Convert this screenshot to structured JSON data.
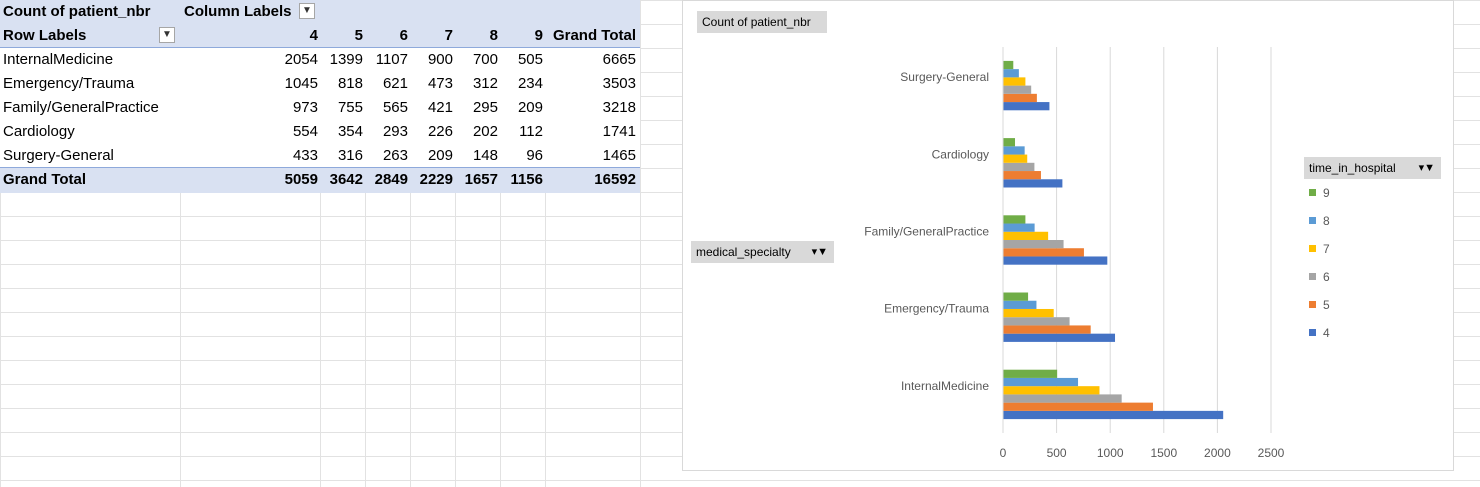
{
  "pivot": {
    "title": "Count of patient_nbr",
    "column_labels": "Column Labels",
    "row_labels": "Row Labels",
    "column_headers": [
      "4",
      "5",
      "6",
      "7",
      "8",
      "9",
      "Grand Total"
    ],
    "rows": [
      {
        "label": "InternalMedicine",
        "values": [
          "2054",
          "1399",
          "1107",
          "900",
          "700",
          "505",
          "6665"
        ]
      },
      {
        "label": "Emergency/Trauma",
        "values": [
          "1045",
          "818",
          "621",
          "473",
          "312",
          "234",
          "3503"
        ]
      },
      {
        "label": "Family/GeneralPractice",
        "values": [
          "973",
          "755",
          "565",
          "421",
          "295",
          "209",
          "3218"
        ]
      },
      {
        "label": "Cardiology",
        "values": [
          "554",
          "354",
          "293",
          "226",
          "202",
          "112",
          "1741"
        ]
      },
      {
        "label": "Surgery-General",
        "values": [
          "433",
          "316",
          "263",
          "209",
          "148",
          "96",
          "1465"
        ]
      }
    ],
    "grand_total": {
      "label": "Grand Total",
      "values": [
        "5059",
        "3642",
        "2849",
        "2229",
        "1657",
        "1156",
        "16592"
      ]
    }
  },
  "chart": {
    "value_field_button": "Count  of patient_nbr",
    "axis_field_button": "medical_specialty",
    "legend_field_button": "time_in_hospital"
  },
  "chart_data": {
    "type": "bar",
    "orientation": "horizontal",
    "categories": [
      "InternalMedicine",
      "Emergency/Trauma",
      "Family/GeneralPractice",
      "Cardiology",
      "Surgery-General"
    ],
    "series": [
      {
        "name": "4",
        "color": "#4472c4",
        "values": [
          2054,
          1045,
          973,
          554,
          433
        ]
      },
      {
        "name": "5",
        "color": "#ed7d31",
        "values": [
          1399,
          818,
          755,
          354,
          316
        ]
      },
      {
        "name": "6",
        "color": "#a5a5a5",
        "values": [
          1107,
          621,
          565,
          293,
          263
        ]
      },
      {
        "name": "7",
        "color": "#ffc000",
        "values": [
          900,
          473,
          421,
          226,
          209
        ]
      },
      {
        "name": "8",
        "color": "#5b9bd5",
        "values": [
          700,
          312,
          295,
          202,
          148
        ]
      },
      {
        "name": "9",
        "color": "#70ad47",
        "values": [
          505,
          234,
          209,
          112,
          96
        ]
      }
    ],
    "legend_order": [
      "9",
      "8",
      "7",
      "6",
      "5",
      "4"
    ],
    "xlim": [
      0,
      2500
    ],
    "xticks": [
      0,
      500,
      1000,
      1500,
      2000,
      2500
    ],
    "gridlines": true,
    "legend_position": "right"
  }
}
